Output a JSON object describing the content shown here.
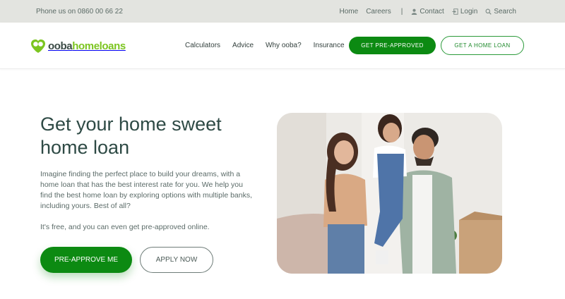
{
  "topbar": {
    "phone": "Phone us on 0860 00 66 22",
    "home": "Home",
    "careers": "Careers",
    "separator": "|",
    "contact": "Contact",
    "login": "Login",
    "search": "Search"
  },
  "brand": {
    "name_part1": "ooba",
    "name_part2": "homeloans",
    "color_dark": "#3a4a45",
    "color_green": "#7cc520"
  },
  "nav": {
    "items": [
      "Calculators",
      "Advice",
      "Why ooba?",
      "Insurance"
    ],
    "cta_primary": "GET PRE-APPROVED",
    "cta_secondary": "GET A HOME LOAN"
  },
  "hero": {
    "title": "Get your home sweet home loan",
    "body": "Imagine finding the perfect place to build your dreams, with a home loan that has the best interest rate for you. We help you find the best home loan by exploring options with multiple banks, including yours. Best of all?",
    "free_note": "It's free, and you can even get pre-approved online.",
    "cta_primary": "PRE-APPROVE ME",
    "cta_secondary": "APPLY NOW"
  },
  "colors": {
    "accent_green": "#0c8a12",
    "heading": "#2e4a45"
  }
}
